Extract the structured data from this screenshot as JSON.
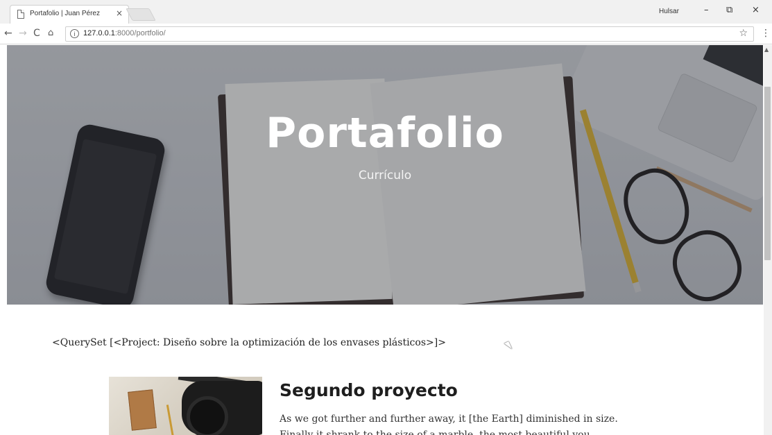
{
  "browser": {
    "tab_title": "Portafolio | Juan Pérez",
    "tab_close": "×",
    "user_label": "Hulsar",
    "window_controls": {
      "minimize": "–",
      "restore": "⧉",
      "close": "×"
    },
    "nav": {
      "back": "←",
      "forward": "→",
      "reload": "C",
      "home": "⌂"
    },
    "url_host": "127.0.0.1",
    "url_rest": ":8000/portfolio/",
    "info_icon": "i",
    "bookmark_icon": "☆",
    "menu_icon": "⋮"
  },
  "hero": {
    "title": "Portafolio",
    "subtitle": "Currículo"
  },
  "content": {
    "queryset_text": "<QuerySet [<Project: Diseño sobre la optimización de los envases plásticos>]>",
    "project": {
      "title": "Segundo proyecto",
      "description_line1": "As we got further and further away, it [the Earth] diminished in size.",
      "description_line2": "Finally it shrank to the size of a marble, the most beautiful you"
    }
  },
  "scrollbar": {
    "up_arrow": "▲"
  }
}
